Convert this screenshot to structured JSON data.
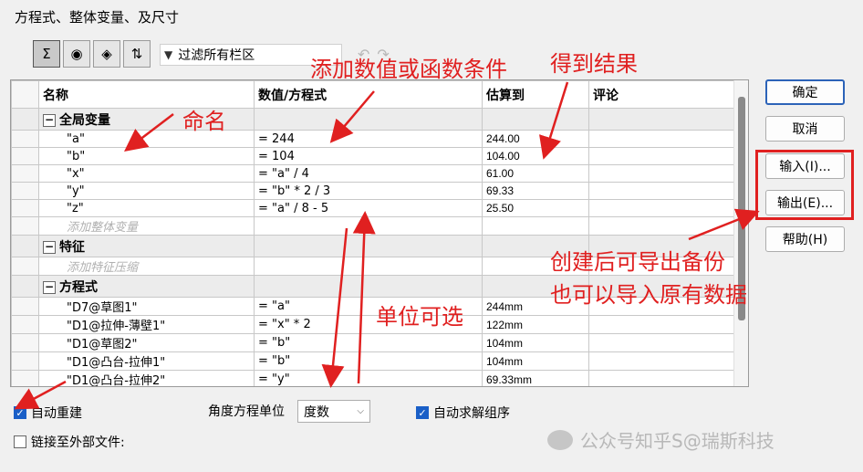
{
  "window": {
    "title": "方程式、整体变量、及尺寸"
  },
  "toolbar": {
    "buttons": [
      {
        "name": "sigma-icon",
        "glyph": "Σ"
      },
      {
        "name": "eye-icon",
        "glyph": "◉"
      },
      {
        "name": "ruler-icon",
        "glyph": "◈"
      },
      {
        "name": "sort-icon",
        "glyph": "⇅"
      }
    ],
    "filter_icon": "funnel-icon",
    "filter_text": "过滤所有栏区"
  },
  "table": {
    "headers": {
      "name": "名称",
      "value": "数值/方程式",
      "eval": "估算到",
      "comment": "评论"
    },
    "groups": [
      {
        "label": "全局变量",
        "rows": [
          {
            "name": "\"a\"",
            "value": "= 244",
            "eval": "244.00"
          },
          {
            "name": "\"b\"",
            "value": "= 104",
            "eval": "104.00"
          },
          {
            "name": "\"x\"",
            "value": "= \"a\" / 4",
            "eval": "61.00"
          },
          {
            "name": "\"y\"",
            "value": "= \"b\" * 2 / 3",
            "eval": "69.33"
          },
          {
            "name": "\"z\"",
            "value": "= \"a\" / 8 - 5",
            "eval": "25.50"
          }
        ],
        "add": "添加整体变量"
      },
      {
        "label": "特征",
        "rows": [],
        "add": "添加特征压缩"
      },
      {
        "label": "方程式",
        "rows": [
          {
            "name": "\"D7@草图1\"",
            "value": "= \"a\"",
            "eval": "244mm"
          },
          {
            "name": "\"D1@拉伸-薄壁1\"",
            "value": "= \"x\" * 2",
            "eval": "122mm"
          },
          {
            "name": "\"D1@草图2\"",
            "value": "= \"b\"",
            "eval": "104mm"
          },
          {
            "name": "\"D1@凸台-拉伸1\"",
            "value": "= \"b\"",
            "eval": "104mm"
          },
          {
            "name": "\"D1@凸台-拉伸2\"",
            "value": "= \"y\"",
            "eval": "69.33mm"
          }
        ],
        "add": ""
      }
    ]
  },
  "buttons": {
    "ok": "确定",
    "cancel": "取消",
    "import": "输入(I)...",
    "export": "输出(E)...",
    "help": "帮助(H)"
  },
  "options": {
    "auto_rebuild": {
      "label": "自动重建",
      "checked": true
    },
    "link_external": {
      "label": "链接至外部文件:",
      "checked": false
    },
    "angle_unit_label": "角度方程单位",
    "angle_unit_value": "度数",
    "auto_solve": {
      "label": "自动求解组序",
      "checked": true
    }
  },
  "annotations": {
    "add_condition": "添加数值或函数条件",
    "get_result": "得到结果",
    "naming": "命名",
    "unit_selectable": "单位可选",
    "export_backup": "创建后可导出备份",
    "import_data": "也可以导入原有数据"
  },
  "watermark": "公众号知乎S@瑞斯科技",
  "colors": {
    "annotation_red": "#e02020",
    "accent_blue": "#1a5fc7"
  }
}
